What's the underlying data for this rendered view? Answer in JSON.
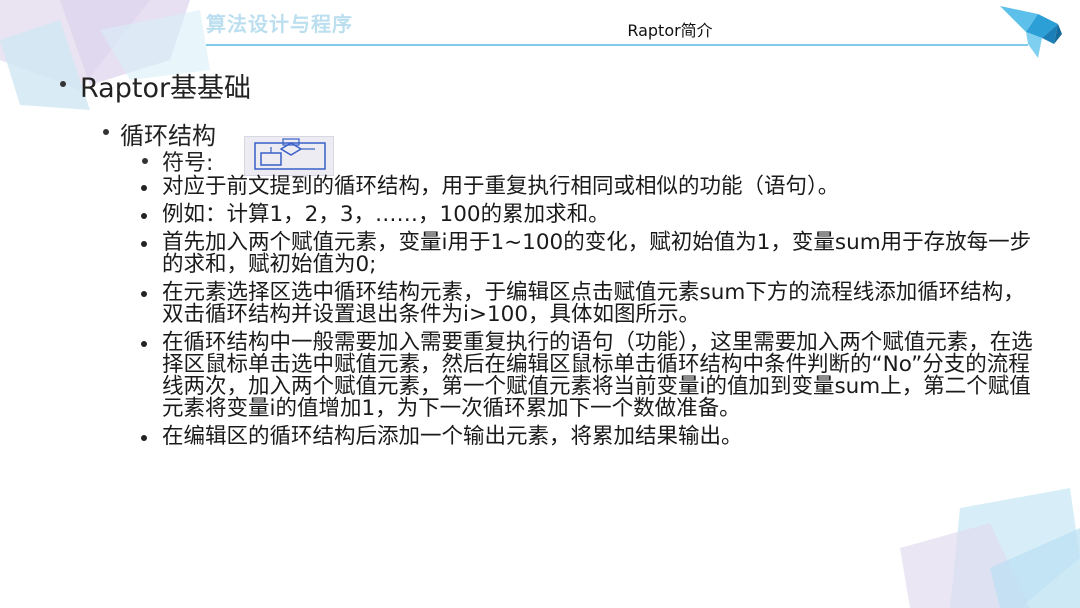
{
  "header": {
    "section_title": "算法设计与程序",
    "subject": "Raptor简介"
  },
  "content": {
    "level1": "Raptor基基础",
    "level2": "循环结构",
    "symbol_label": "符号:",
    "items": [
      "对应于前文提到的循环结构，用于重复执行相同或相似的功能（语句）。",
      "例如：计算1，2，3，……，100的累加求和。",
      "首先加入两个赋值元素，变量i用于1~100的变化，赋初始值为1，变量sum用于存放每一步的求和，赋初始值为0;",
      "在元素选择区选中循环结构元素，于编辑区点击赋值元素sum下方的流程线添加循环结构，双击循环结构并设置退出条件为i>100，具体如图所示。",
      "在循环结构中一般需要加入需要重复执行的语句（功能），这里需要加入两个赋值元素，在选择区鼠标单击选中赋值元素，然后在编辑区鼠标单击循环结构中条件判断的“No”分支的流程线两次，加入两个赋值元素，第一个赋值元素将当前变量i的值加到变量sum上，第二个赋值元素将变量i的值增加1，为下一次循环累加下一个数做准备。",
      "在编辑区的循环结构后添加一个输出元素，将累加结果输出。"
    ]
  },
  "colors": {
    "header_title": "#bcdff0",
    "header_rule": "#7fcbe8",
    "accent_blue": "#3aaee0"
  },
  "icons": {
    "bird": "bird-logo-icon",
    "loop_symbol": "loop-flowchart-icon"
  }
}
